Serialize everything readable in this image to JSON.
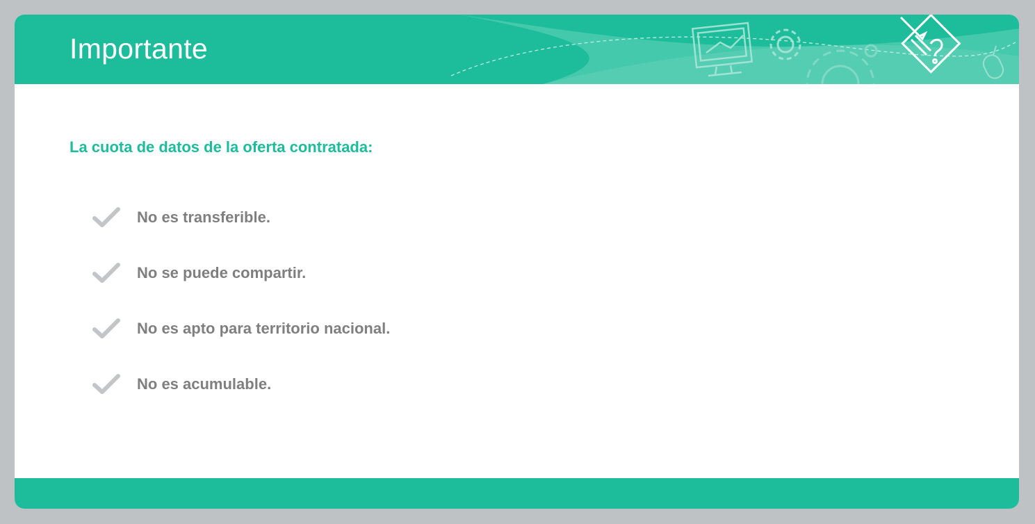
{
  "header": {
    "title": "Importante"
  },
  "content": {
    "subtitle": "La cuota de datos de la oferta contratada:",
    "items": [
      {
        "text": "No es transferible.",
        "icon": "checkmark-icon"
      },
      {
        "text": "No se puede compartir.",
        "icon": "checkmark-icon"
      },
      {
        "text": "No es apto para territorio nacional.",
        "icon": "checkmark-icon"
      },
      {
        "text": "No es acumulable.",
        "icon": "checkmark-icon"
      }
    ]
  },
  "colors": {
    "accent": "#1dbc9a",
    "text": "#7f7f7f",
    "check": "#c3c6c9",
    "frame": "#bfc2c5"
  }
}
